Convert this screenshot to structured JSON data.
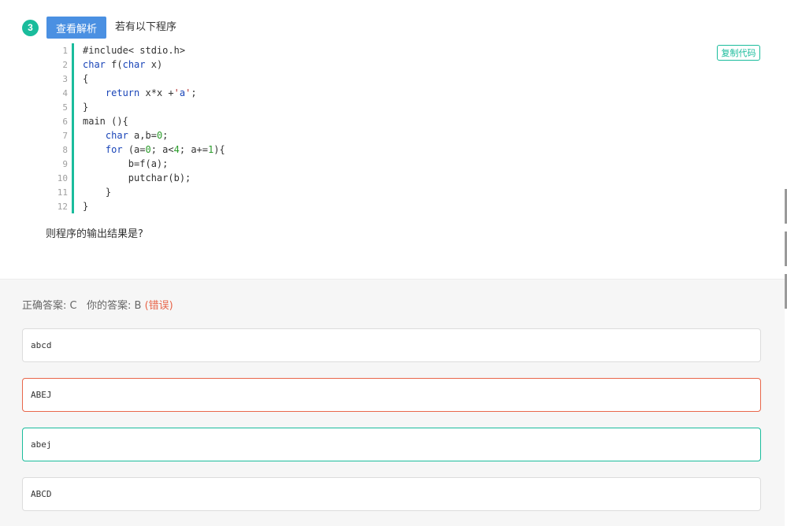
{
  "question": {
    "number": "3",
    "view_analysis_label": "查看解析",
    "title": "若有以下程序",
    "copy_code_label": "复制代码",
    "footer": "则程序的输出结果是?"
  },
  "code_lines": [
    {
      "n": "1",
      "html": "#include&lt; stdio.h&gt;"
    },
    {
      "n": "2",
      "html": "<span class=\"kw\">char</span> f(<span class=\"kw\">char</span> x)"
    },
    {
      "n": "3",
      "html": "{"
    },
    {
      "n": "4",
      "html": "    <span class=\"kw\">return</span> x*x +<span class=\"str-red\">'</span><span class=\"str\">a</span><span class=\"str-red\">'</span>;"
    },
    {
      "n": "5",
      "html": "}"
    },
    {
      "n": "6",
      "html": "main (){"
    },
    {
      "n": "7",
      "html": "    <span class=\"kw\">char</span> a,b=<span class=\"num\">0</span>;"
    },
    {
      "n": "8",
      "html": "    <span class=\"kw\">for</span> (a=<span class=\"num\">0</span>; a&lt;<span class=\"num\">4</span>; a+=<span class=\"num\">1</span>){"
    },
    {
      "n": "9",
      "html": "        b=f(a);"
    },
    {
      "n": "10",
      "html": "        putchar(b);"
    },
    {
      "n": "11",
      "html": "    }"
    },
    {
      "n": "12",
      "html": "}"
    }
  ],
  "answer": {
    "correct_label": "正确答案: C",
    "yours_label": "你的答案: B",
    "wrong_tag": "(错误)"
  },
  "options": [
    {
      "text": "abcd",
      "state": "normal"
    },
    {
      "text": "ABEJ",
      "state": "wrong"
    },
    {
      "text": "abej",
      "state": "correct"
    },
    {
      "text": "ABCD",
      "state": "normal"
    }
  ],
  "colors": {
    "accent": "#1abc9c",
    "button_blue": "#4a90e2",
    "error": "#e8664a"
  }
}
